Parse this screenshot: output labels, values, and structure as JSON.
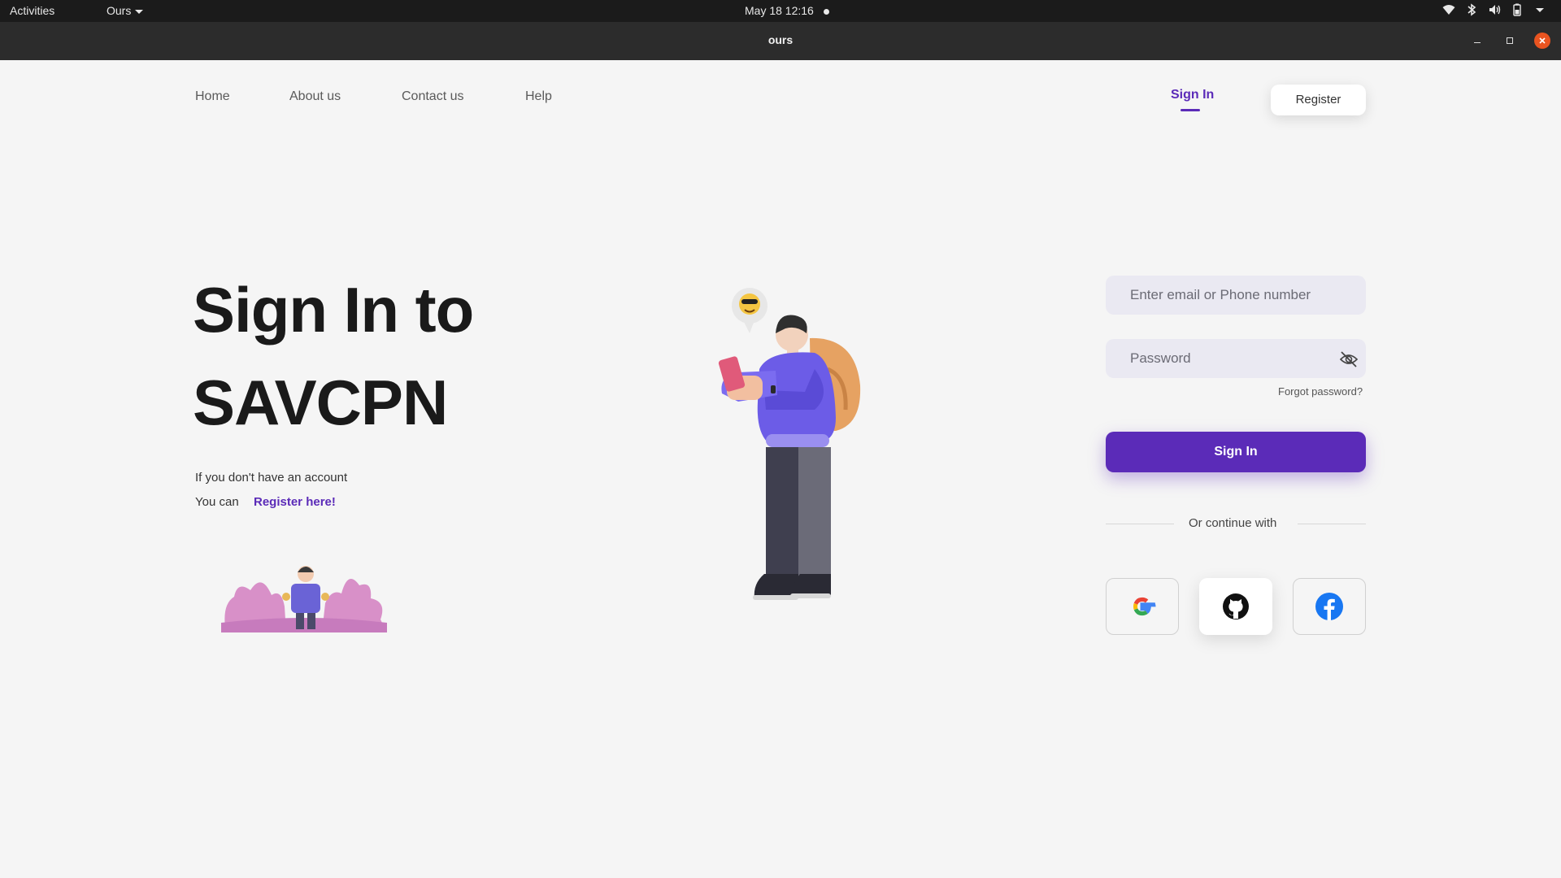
{
  "system_bar": {
    "activities": "Activities",
    "app_menu": "Ours",
    "clock": "May 18  12:16",
    "icons": [
      "wifi-icon",
      "bluetooth-icon",
      "volume-icon",
      "battery-icon",
      "system-menu-icon"
    ]
  },
  "window": {
    "title": "ours"
  },
  "nav": {
    "links": [
      "Home",
      "About us",
      "Contact us",
      "Help"
    ],
    "signin": "Sign In",
    "register": "Register"
  },
  "hero": {
    "title_line1": "Sign In to",
    "title_line2": "SAVCPN",
    "account_text": "If you don't have an account",
    "you_can": "You can",
    "register_here": "Register here!"
  },
  "form": {
    "email_placeholder": "Enter email or Phone number",
    "password_placeholder": "Password",
    "forgot": "Forgot password?",
    "signin_button": "Sign In",
    "continue_with": "Or continue with",
    "social": [
      "google-icon",
      "github-icon",
      "facebook-icon"
    ]
  },
  "colors": {
    "accent": "#5b2bb8",
    "background": "#f5f5f5",
    "input_bg": "#eae9f2"
  }
}
